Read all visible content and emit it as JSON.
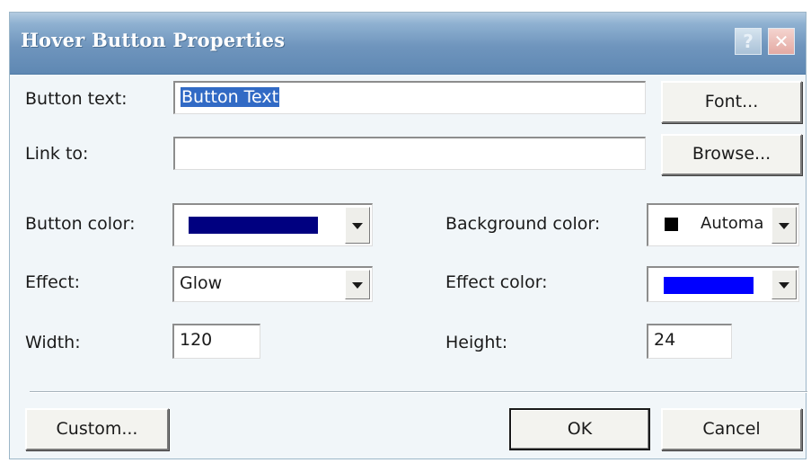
{
  "dialog": {
    "title": "Hover Button Properties",
    "help_glyph": "?",
    "close_glyph": "✕"
  },
  "form": {
    "button_text_label": "Button text:",
    "button_text_value": "Button Text",
    "font_button": "Font...",
    "link_to_label": "Link to:",
    "link_to_value": "",
    "browse_button": "Browse...",
    "button_color_label": "Button color:",
    "button_color_value": "#000080",
    "background_color_label": "Background color:",
    "background_color_value": "Automa",
    "background_swatch": "#000000",
    "effect_label": "Effect:",
    "effect_value": "Glow",
    "effect_color_label": "Effect color:",
    "effect_color_value": "#0000ff",
    "width_label": "Width:",
    "width_value": "120",
    "height_label": "Height:",
    "height_value": "24"
  },
  "footer": {
    "custom_button": "Custom...",
    "ok_button": "OK",
    "cancel_button": "Cancel"
  },
  "icons": {
    "dropdown": "chevron-down-icon",
    "help": "help-icon",
    "close": "close-icon"
  }
}
